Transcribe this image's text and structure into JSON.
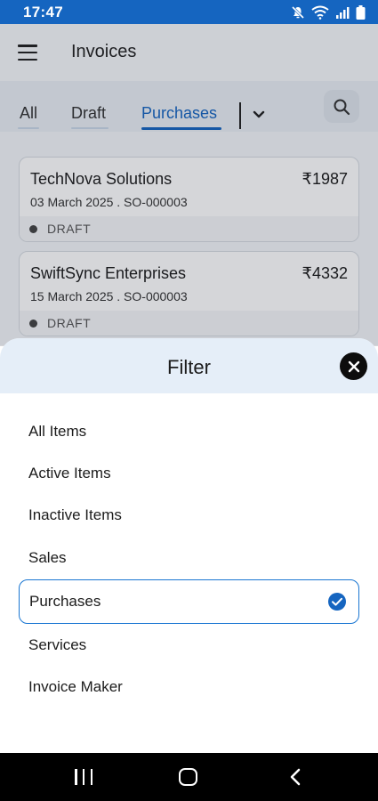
{
  "status_bar": {
    "time": "17:47",
    "icons": [
      "mute-icon",
      "wifi-icon",
      "signal-icon",
      "battery-icon"
    ]
  },
  "app_bar": {
    "title": "Invoices",
    "menu_icon": "hamburger-menu-icon"
  },
  "tabs": {
    "items": [
      {
        "label": "All",
        "active": false
      },
      {
        "label": "Draft",
        "active": false
      },
      {
        "label": "Purchases",
        "active": true
      }
    ],
    "more_icon": "chevron-down-icon",
    "search_icon": "search-icon"
  },
  "invoices": [
    {
      "name": "TechNova Solutions",
      "amount": "₹1987",
      "meta": "03 March 2025 . SO-000003",
      "status": "DRAFT"
    },
    {
      "name": "SwiftSync Enterprises",
      "amount": "₹4332",
      "meta": "15 March 2025 . SO-000003",
      "status": "DRAFT"
    }
  ],
  "filter_sheet": {
    "title": "Filter",
    "close_icon": "close-icon",
    "options": [
      {
        "label": "All Items",
        "selected": false
      },
      {
        "label": "Active Items",
        "selected": false
      },
      {
        "label": "Inactive Items",
        "selected": false
      },
      {
        "label": "Sales",
        "selected": false
      },
      {
        "label": "Purchases",
        "selected": true
      },
      {
        "label": "Services",
        "selected": false
      },
      {
        "label": "Invoice Maker",
        "selected": false
      }
    ],
    "check_icon": "check-circle-icon"
  },
  "colors": {
    "accent": "#1565c0",
    "selected_border": "#1976d2",
    "sheet_header": "#e5eef8"
  },
  "nav_bar": {
    "icons": [
      "recents-icon",
      "home-icon",
      "back-icon"
    ]
  }
}
